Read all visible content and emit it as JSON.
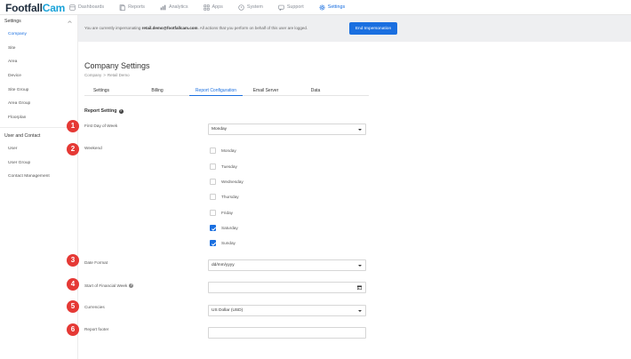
{
  "brand": {
    "part1": "Footfall",
    "part2": "Cam"
  },
  "nav": [
    {
      "label": "Dashboards",
      "icon": "dashboard-icon"
    },
    {
      "label": "Reports",
      "icon": "reports-icon"
    },
    {
      "label": "Analytics",
      "icon": "analytics-icon"
    },
    {
      "label": "Apps",
      "icon": "apps-icon"
    },
    {
      "label": "System",
      "icon": "system-icon"
    },
    {
      "label": "Support",
      "icon": "support-icon"
    },
    {
      "label": "Settings",
      "icon": "settings-icon",
      "active": true
    }
  ],
  "sidebar": {
    "group1": "Settings",
    "items1": [
      "Company",
      "Site",
      "Area",
      "Device",
      "Site Group",
      "Area Group",
      "Floorplan"
    ],
    "group2": "User and Contact",
    "items2": [
      "User",
      "User Group",
      "Contact Management"
    ]
  },
  "banner": {
    "prefix": "You are currently impersonating ",
    "email": "retail.demo@footfallcam.com",
    "suffix": ". All actions that you perform on behalf of this user are logged.",
    "button": "End Impersonation"
  },
  "page": {
    "title": "Company Settings",
    "breadcrumb": [
      "Company",
      ">",
      "Retail Demo"
    ],
    "tabs": [
      "Settings",
      "Billing",
      "Report Configuration",
      "Email Server",
      "Data"
    ]
  },
  "report": {
    "section_title": "Report Setting",
    "first_day_label": "First Day of Week",
    "first_day_value": "Monday",
    "weekend_label": "Weekend",
    "weekend_days": [
      {
        "label": "Monday",
        "checked": false
      },
      {
        "label": "Tuesday",
        "checked": false
      },
      {
        "label": "Wednesday",
        "checked": false
      },
      {
        "label": "Thursday",
        "checked": false
      },
      {
        "label": "Friday",
        "checked": false
      },
      {
        "label": "Saturday",
        "checked": true
      },
      {
        "label": "Sunday",
        "checked": true
      }
    ],
    "date_format_label": "Date Format",
    "date_format_value": "dd/mm/yyyy",
    "financial_week_label": "Start of Financial Week",
    "financial_week_value": "",
    "currencies_label": "Currencies",
    "currencies_value": "US Dollar (USD)",
    "footer_label": "Report footer",
    "footer_value": ""
  },
  "markers": [
    "1",
    "2",
    "3",
    "4",
    "5",
    "6"
  ],
  "colors": {
    "accent": "#1a6fe0",
    "marker": "#e53935",
    "brand_cam": "#1aa3d9"
  }
}
